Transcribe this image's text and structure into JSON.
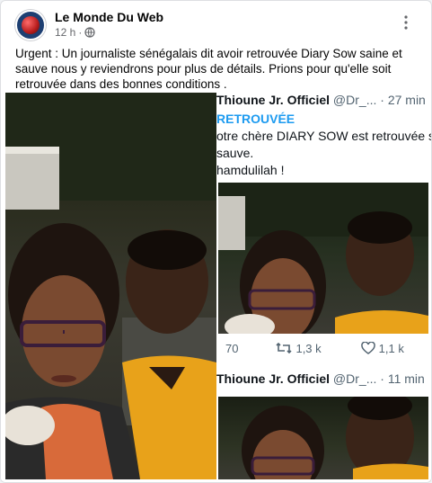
{
  "post": {
    "page_name": "Le Monde Du Web",
    "time": "12 h",
    "separator": "·",
    "privacy_icon": "globe-icon",
    "more_icon": "more-icon",
    "text": "Urgent : Un journaliste sénégalais dit avoir retrouvée Diary Sow saine et sauve nous y reviendrons pour plus de détails. Prions pour qu'elle soit retrouvée dans des bonnes conditions ."
  },
  "tweet1": {
    "author": "Thioune Jr. Officiel",
    "handle": "@Dr_...",
    "time": "· 27 min",
    "headline": "RETROUVÉE",
    "line1": "otre chère DIARY SOW est retrouvée s",
    "line2": "sauve.",
    "line3": "hamdulilah !",
    "replies": "70",
    "retweets": "1,3 k",
    "likes": "1,1 k"
  },
  "tweet2": {
    "author": "Thioune Jr. Officiel",
    "handle": "@Dr_...",
    "time": "· 11 min"
  },
  "colors": {
    "facebook_text": "#050505",
    "meta": "#65676b",
    "twitter_blue": "#1d9bf0",
    "twitter_gray": "#536471",
    "orange_shirt": "#e8a21a"
  }
}
